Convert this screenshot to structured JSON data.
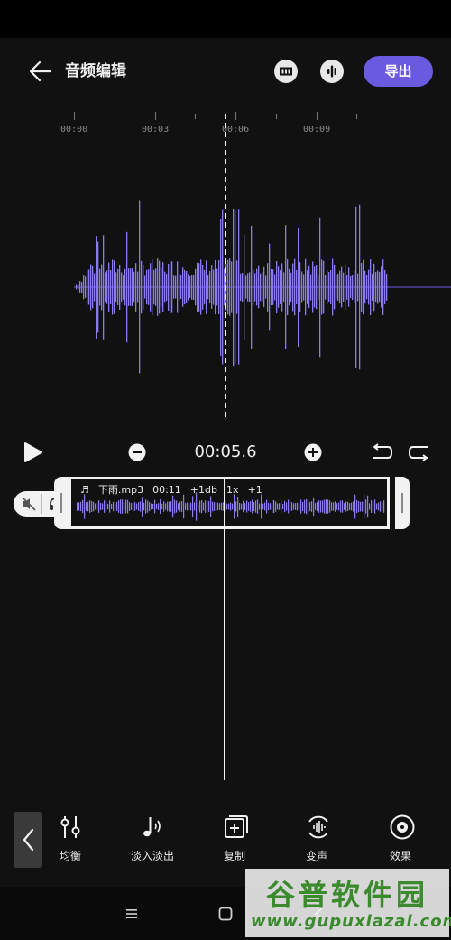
{
  "header": {
    "title": "音频编辑",
    "export_label": "导出"
  },
  "ruler": {
    "labels": [
      "00:00",
      "00:03",
      "00:06",
      "00:09"
    ]
  },
  "controls": {
    "current_time": "00:05.6"
  },
  "clip": {
    "filename": "下雨.mp3",
    "duration": "00:11",
    "gain": "+1db",
    "speed": "1x",
    "pitch": "+1"
  },
  "toolbar": {
    "items": [
      {
        "label": "均衡",
        "icon": "equalizer-icon"
      },
      {
        "label": "淡入淡出",
        "icon": "fade-note-icon"
      },
      {
        "label": "复制",
        "icon": "copy-icon"
      },
      {
        "label": "变声",
        "icon": "voice-change-icon"
      },
      {
        "label": "效果",
        "icon": "effect-disc-icon"
      }
    ]
  },
  "watermark": {
    "title": "谷普软件园",
    "url": "www.gupuxiazai.com"
  },
  "colors": {
    "accent": "#6a5ae0",
    "waveform": "#8a7cf0",
    "background": "#111111"
  }
}
